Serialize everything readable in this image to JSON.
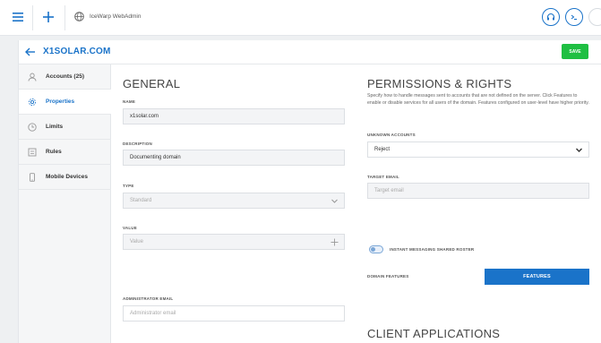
{
  "topbar": {
    "menu_icon": "hamburger-menu-icon",
    "add_icon": "plus-icon",
    "app_name": "IceWarp WebAdmin",
    "support_icon": "headset-icon",
    "console_icon": "terminal-icon",
    "extra_icon": "circle-icon"
  },
  "header": {
    "title": "X1SOLAR.COM",
    "save_label": "SAVE",
    "accent": "#1a73c9",
    "save_color": "#1fbf42"
  },
  "sidebar": {
    "items": [
      {
        "label": "Accounts (25)",
        "icon": "user-icon",
        "active": false
      },
      {
        "label": "Properties",
        "icon": "gear-icon",
        "active": true
      },
      {
        "label": "Limits",
        "icon": "clock-icon",
        "active": false
      },
      {
        "label": "Rules",
        "icon": "rules-icon",
        "active": false
      },
      {
        "label": "Mobile Devices",
        "icon": "phone-icon",
        "active": false
      }
    ]
  },
  "general": {
    "heading": "GENERAL",
    "name_label": "NAME",
    "name_value": "x1solar.com",
    "description_label": "DESCRIPTION",
    "description_value": "Documenting domain",
    "type_label": "TYPE",
    "type_value": "Standard",
    "value_label": "VALUE",
    "value_placeholder": "Value",
    "admin_email_label": "ADMINISTRATOR EMAIL",
    "admin_email_placeholder": "Administrator email"
  },
  "permissions": {
    "heading": "PERMISSIONS & RIGHTS",
    "description": "Specify how to handle messages sent to accounts that are not defined on the server. Click Features to enable or disable services for all users of the domain. Features configured on user-level have higher priority.",
    "unknown_label": "UNKNOWN ACCOUNTS",
    "unknown_value": "Reject",
    "target_label": "TARGET EMAIL",
    "target_placeholder": "Target email",
    "im_roster_label": "INSTANT MESSAGING SHARED ROSTER",
    "domain_features_label": "DOMAIN FEATURES",
    "features_button": "FEATURES"
  },
  "client_apps": {
    "heading": "CLIENT APPLICATIONS"
  }
}
